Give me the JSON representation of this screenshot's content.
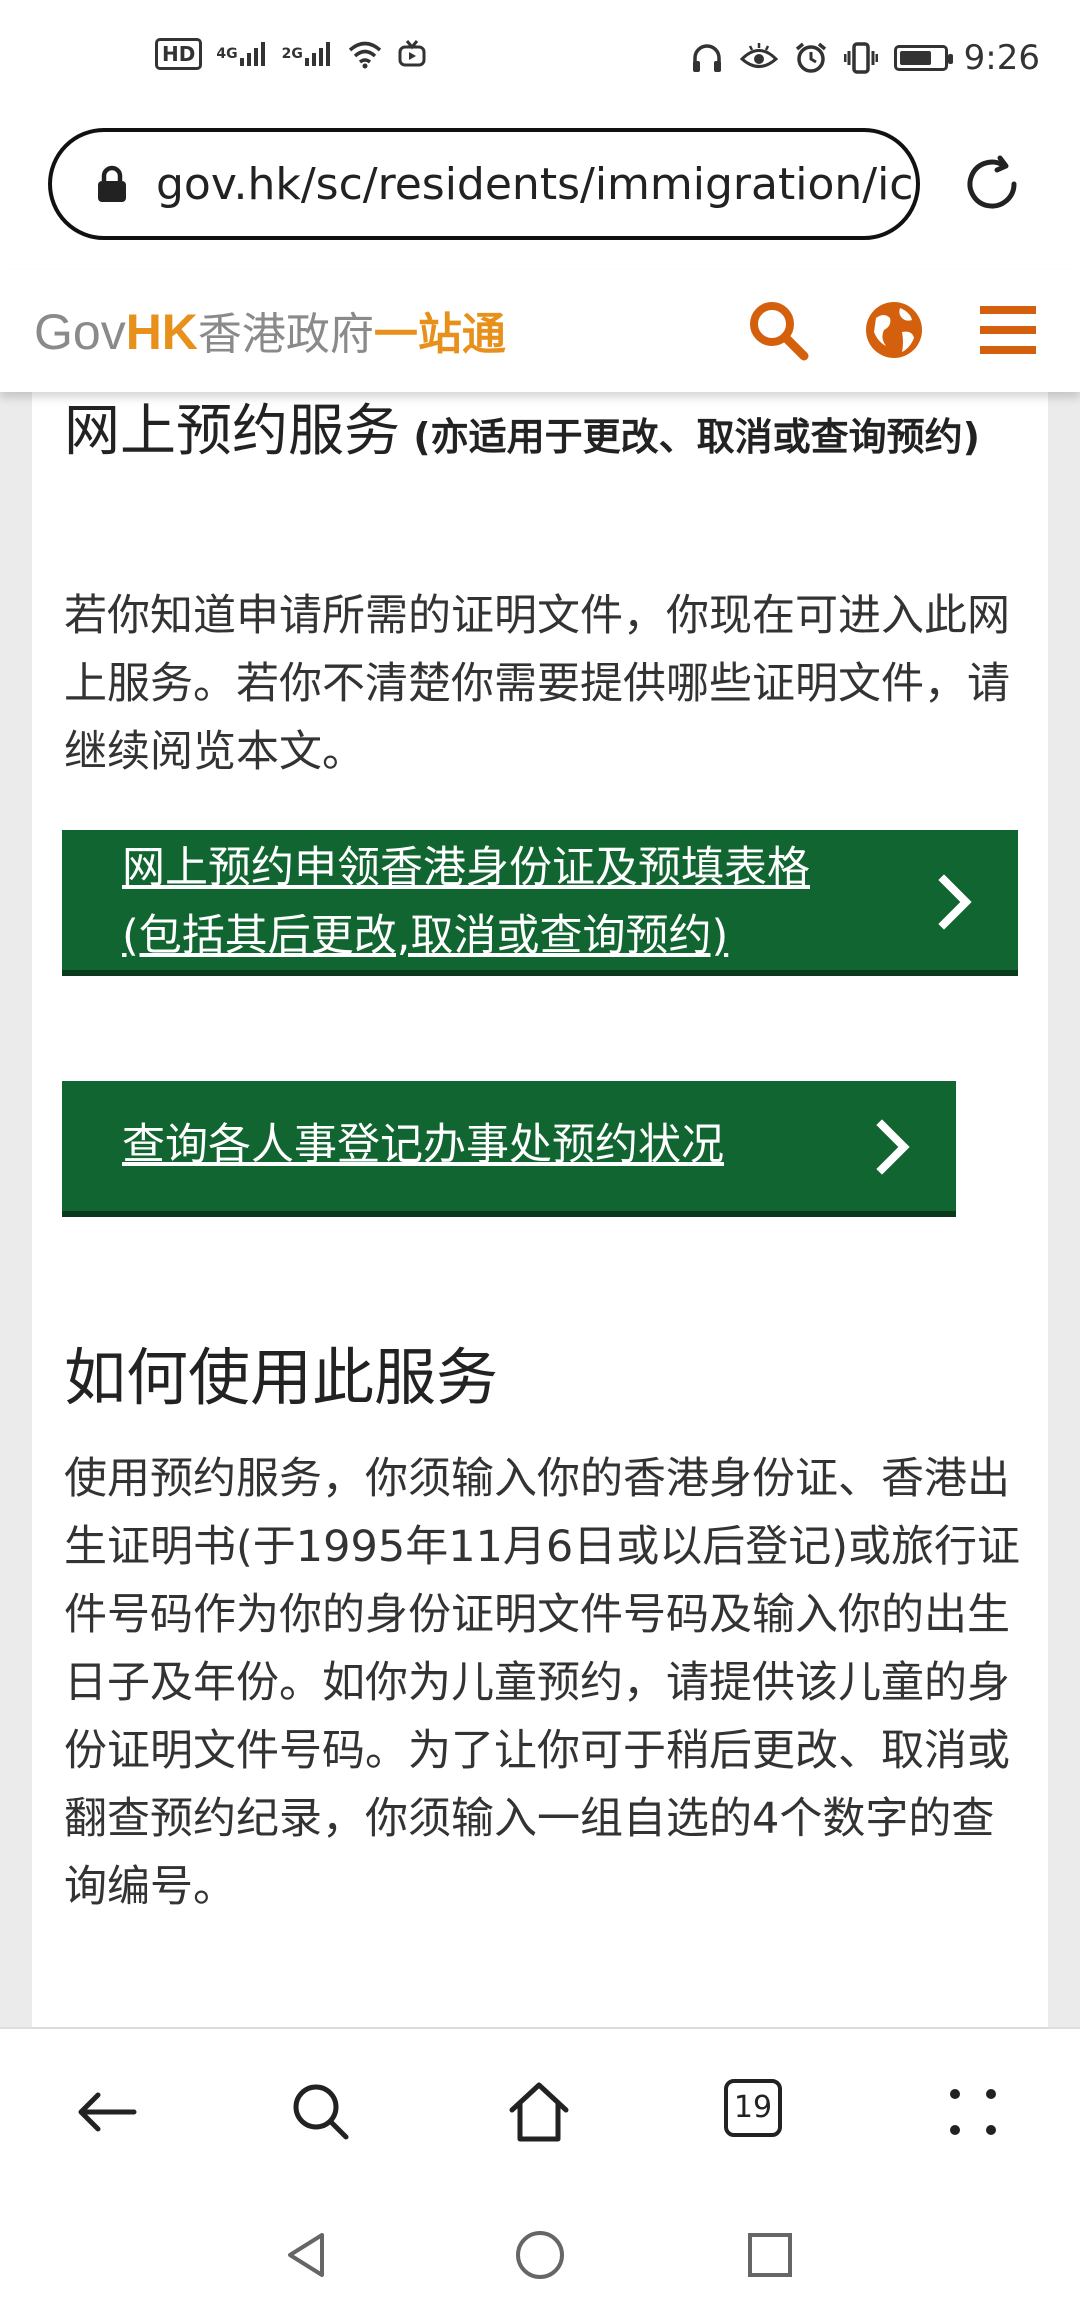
{
  "status_bar": {
    "left_icons": [
      "HD",
      "4G",
      "2G",
      "wifi-icon",
      "tv-icon"
    ],
    "right_icons": [
      "headphones-icon",
      "eye-icon",
      "alarm-icon",
      "vibrate-icon",
      "battery-icon"
    ],
    "hd_label": "HD",
    "sim1_label": "4G",
    "sim2_label": "2G",
    "time": "9:26",
    "battery_level": 0.75
  },
  "browser": {
    "url": "gov.hk/sc/residents/immigration/ic",
    "tab_count": "19"
  },
  "header": {
    "logo_gov": "Gov",
    "logo_hk": "HK",
    "logo_zh": "香港政府",
    "logo_zh2": "一站通"
  },
  "main": {
    "section1_title": "网上预约服务",
    "section1_note": " (亦适用于更改、取消或查询预约)",
    "section1_para": "若你知道申请所需的证明文件，你现在可进入此网上服务。若你不清楚你需要提供哪些证明文件，请继续阅览本文。",
    "button1_line1": "网上预约申领香港身份证及预填表格",
    "button1_line2": "(包括其后更改,取消或查询预约)",
    "button2_label": "查询各人事登记办事处预约状况",
    "section2_title": "如何使用此服务",
    "section2_para": "使用预约服务，你须输入你的香港身份证、香港出生证明书(于1995年11月6日或以后登记)或旅行证件号码作为你的身份证明文件号码及输入你的出生日子及年份。如你为儿童预约，请提供该儿童的身份证明文件号码。为了让你可于稍后更改、取消或翻查预约纪录，你须输入一组自选的4个数字的查询编号。"
  },
  "colors": {
    "brand_orange": "#e8901c",
    "icon_orange": "#d4600e",
    "button_green": "#116530"
  }
}
